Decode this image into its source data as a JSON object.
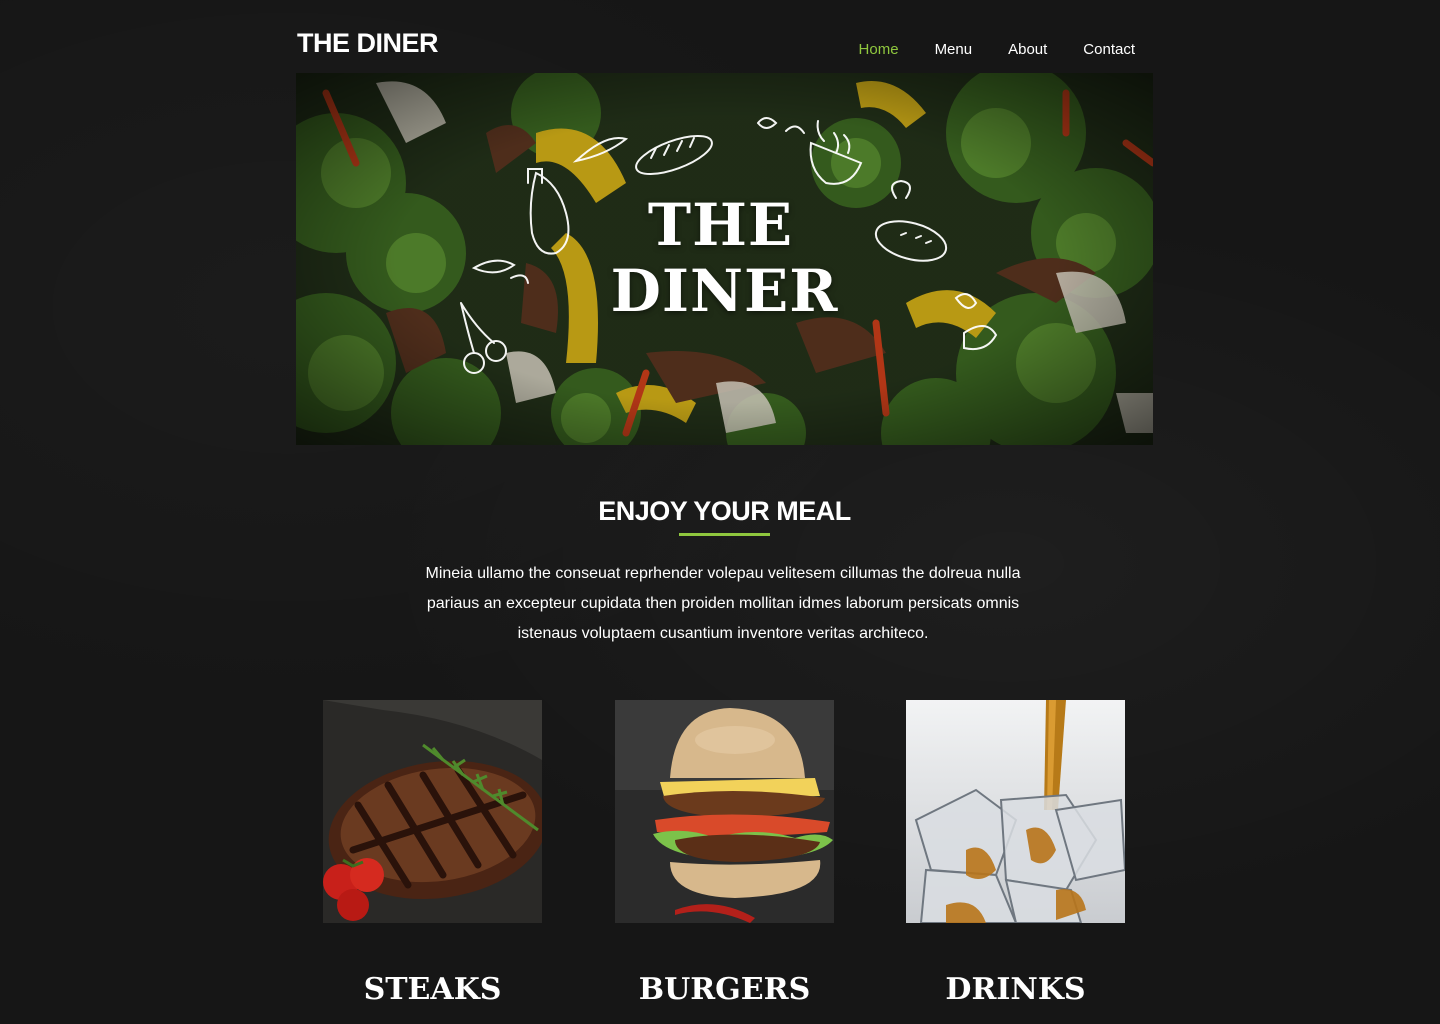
{
  "header": {
    "brand": "THE DINER",
    "nav": [
      {
        "label": "Home",
        "active": true
      },
      {
        "label": "Menu",
        "active": false
      },
      {
        "label": "About",
        "active": false
      },
      {
        "label": "Contact",
        "active": false
      }
    ]
  },
  "hero": {
    "title_line1": "THE",
    "title_line2": "DINER"
  },
  "intro": {
    "heading": "ENJOY YOUR MEAL",
    "text": "Mineia ullamo the conseuat reprhender volepau velitesem cillumas the dolreua nulla pariaus an excepteur cupidata then proiden mollitan idmes laborum persicats omnis istenaus voluptaem cusantium inventore veritas architeco."
  },
  "categories": [
    {
      "title": "STEAKS"
    },
    {
      "title": "BURGERS"
    },
    {
      "title": "DRINKS"
    }
  ],
  "colors": {
    "accent": "#8fc73e",
    "background": "#161616",
    "text": "#ffffff"
  }
}
